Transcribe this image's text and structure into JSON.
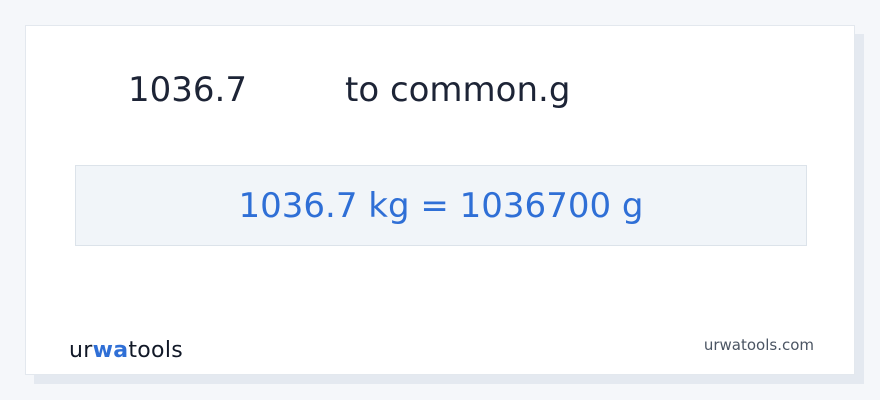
{
  "conversion": {
    "value": "1036.7",
    "to_text": "to common.g",
    "result": "1036.7 kg = 1036700 g"
  },
  "branding": {
    "logo_prefix": "ur",
    "logo_accent": "wa",
    "logo_suffix": "tools",
    "url": "urwatools.com"
  },
  "colors": {
    "accent": "#2f6fd6",
    "text": "#1d2436",
    "result_bg": "#f1f5f9"
  }
}
